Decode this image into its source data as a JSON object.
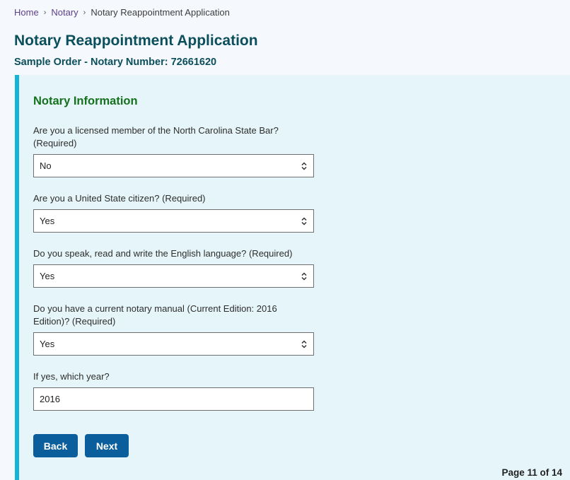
{
  "breadcrumb": {
    "items": [
      "Home",
      "Notary"
    ],
    "current": "Notary Reappointment Application",
    "separator": "›"
  },
  "header": {
    "title": "Notary Reappointment Application",
    "subtitle": "Sample Order - Notary Number: 72661620"
  },
  "section": {
    "title": "Notary Information",
    "fields": [
      {
        "label_line1": "Are you a licensed member of the North Carolina State Bar?",
        "label_line2": "(Required)",
        "type": "select",
        "value": "No"
      },
      {
        "label_line1": "Are you a United State citizen? (Required)",
        "type": "select",
        "value": "Yes"
      },
      {
        "label_line1": "Do you speak, read and write the English language? (Required)",
        "type": "select",
        "value": "Yes"
      },
      {
        "label_line1": "Do you have a current notary manual (Current Edition: 2016",
        "label_line2": "Edition)? (Required)",
        "type": "select",
        "value": "Yes"
      },
      {
        "label_line1": "If yes, which year?",
        "type": "text",
        "value": "2016"
      }
    ]
  },
  "buttons": {
    "back": "Back",
    "next": "Next"
  },
  "pagination": {
    "text": "Page 11 of 14"
  },
  "colors": {
    "title": "#0b4f5c",
    "section_title": "#15711e",
    "panel_bg": "#e6f5f9",
    "panel_accent": "#14b4d8",
    "button": "#0b5e9c",
    "link": "#5c3f8a"
  }
}
